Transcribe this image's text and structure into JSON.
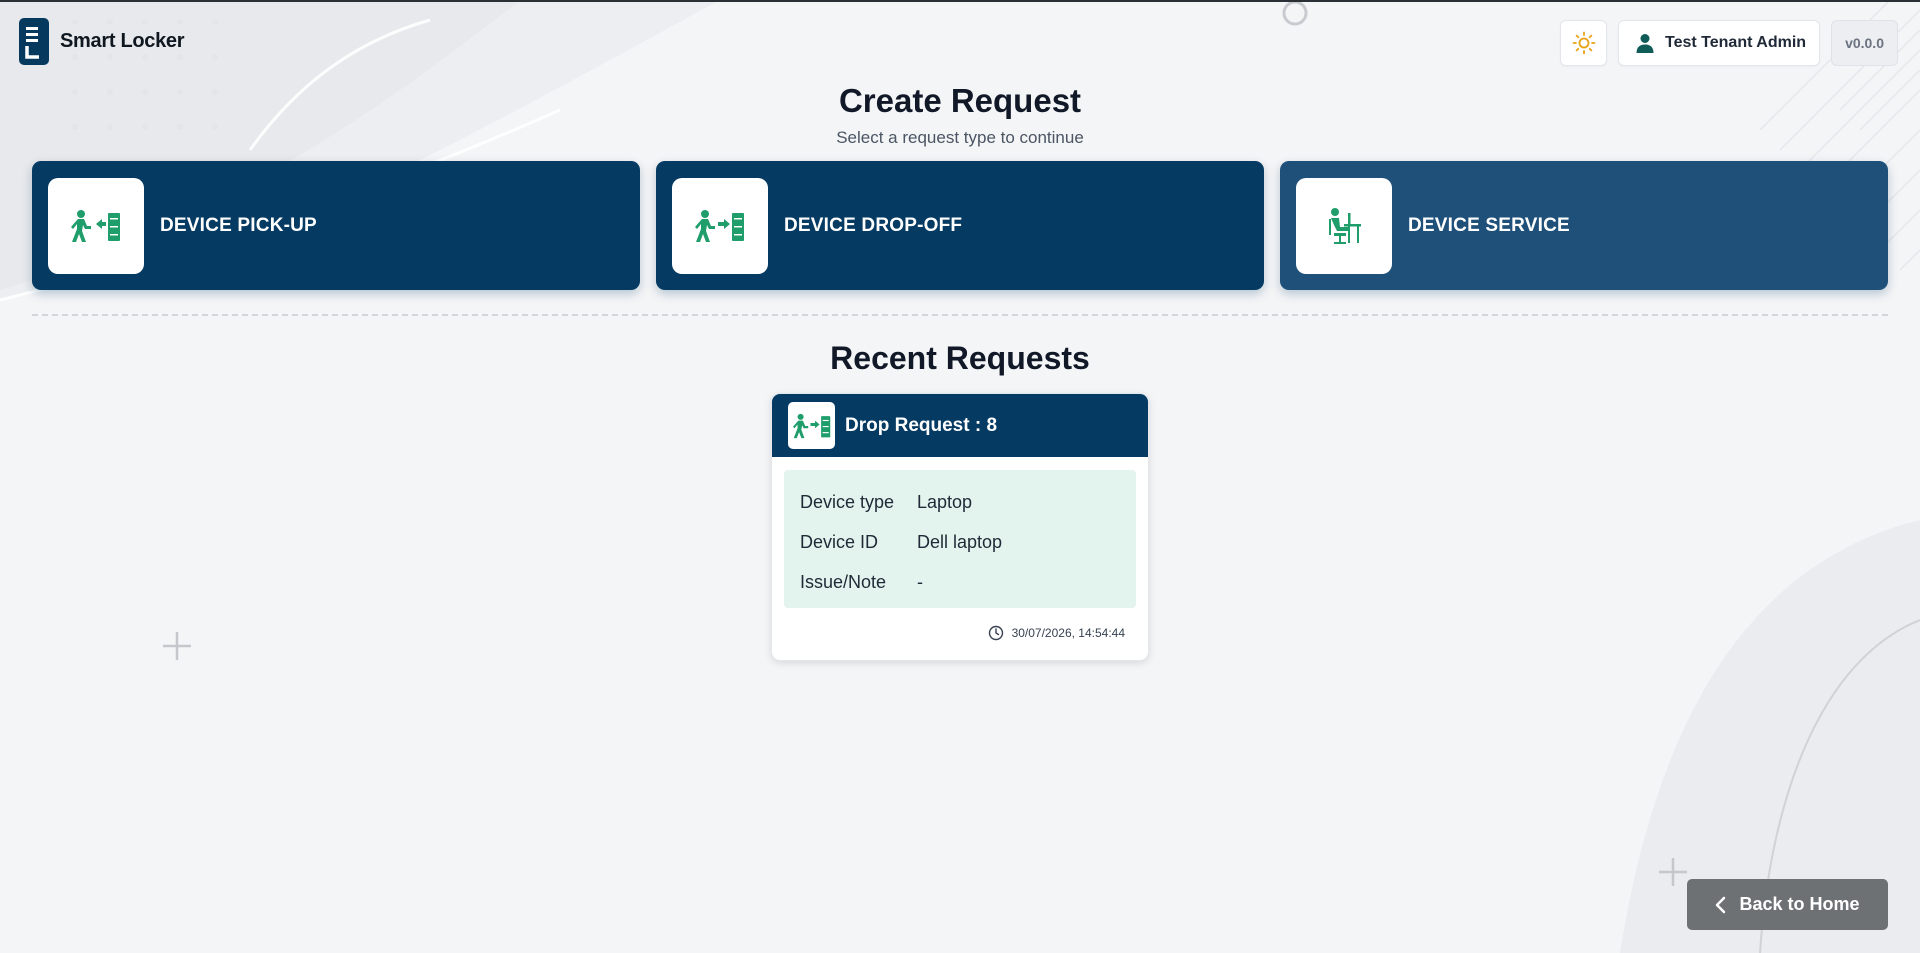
{
  "app": {
    "name": "Smart Locker"
  },
  "header": {
    "theme_icon": "sun-icon",
    "user_name": "Test Tenant Admin",
    "version": "v0.0.0"
  },
  "page": {
    "title": "Create Request",
    "subtitle": "Select a request type to continue"
  },
  "request_types": [
    {
      "label": "DEVICE PICK-UP",
      "icon": "pickup-icon"
    },
    {
      "label": "DEVICE DROP-OFF",
      "icon": "dropoff-icon"
    },
    {
      "label": "DEVICE SERVICE",
      "icon": "service-icon"
    }
  ],
  "recent": {
    "title": "Recent Requests",
    "items": [
      {
        "title": "Drop Request : 8",
        "fields": [
          {
            "label": "Device type",
            "value": "Laptop"
          },
          {
            "label": "Device ID",
            "value": "Dell laptop"
          },
          {
            "label": "Issue/Note",
            "value": "-"
          }
        ],
        "timestamp": "30/07/2026, 14:54:44"
      }
    ]
  },
  "footer": {
    "back_label": "Back to Home"
  },
  "colors": {
    "primary": "#053a62",
    "primary_alt": "#1e5079",
    "accent_green": "#1f9d6b",
    "sun": "#e8a317",
    "back_button": "#6e7174"
  }
}
